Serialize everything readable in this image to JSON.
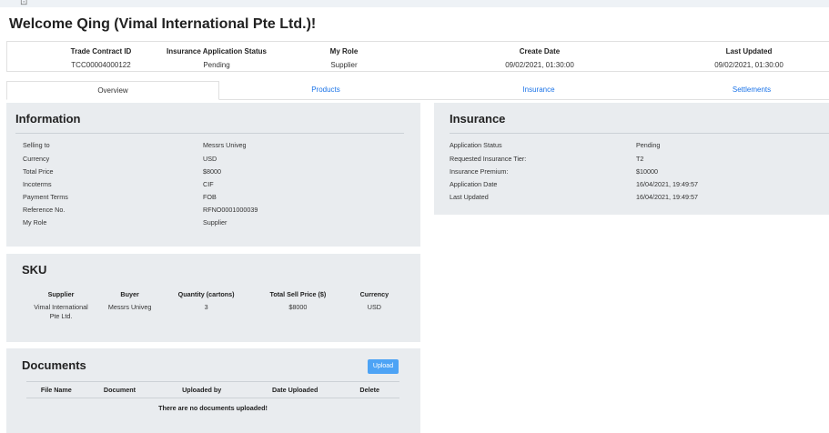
{
  "top_glyph": "⊡",
  "welcome": "Welcome Qing (Vimal International Pte Ltd.)!",
  "summary": {
    "cols": [
      {
        "label": "Trade Contract ID",
        "value": "TCC00004000122"
      },
      {
        "label": "Insurance Application Status",
        "value": "Pending"
      },
      {
        "label": "My Role",
        "value": "Supplier"
      },
      {
        "label": "Create Date",
        "value": "09/02/2021, 01:30:00"
      },
      {
        "label": "Last Updated",
        "value": "09/02/2021, 01:30:00"
      }
    ]
  },
  "tabs": [
    {
      "label": "Overview",
      "active": true
    },
    {
      "label": "Products",
      "active": false
    },
    {
      "label": "Insurance",
      "active": false
    },
    {
      "label": "Settlements",
      "active": false
    }
  ],
  "information": {
    "title": "Information",
    "rows": [
      {
        "key": "Selling to",
        "value": "Messrs Univeg"
      },
      {
        "key": "Currency",
        "value": "USD"
      },
      {
        "key": "Total Price",
        "value": "$8000"
      },
      {
        "key": "Incoterms",
        "value": "CIF"
      },
      {
        "key": "Payment Terms",
        "value": "FOB"
      },
      {
        "key": "Reference No.",
        "value": "RFNO0001000039"
      },
      {
        "key": "My Role",
        "value": "Supplier"
      }
    ]
  },
  "insurance": {
    "title": "Insurance",
    "rows": [
      {
        "key": "Application Status",
        "value": "Pending"
      },
      {
        "key": "Requested Insurance Tier:",
        "value": "T2"
      },
      {
        "key": "Insurance Premium:",
        "value": "$10000"
      },
      {
        "key": "Application Date",
        "value": "16/04/2021, 19:49:57"
      },
      {
        "key": "Last Updated",
        "value": "16/04/2021, 19:49:57"
      }
    ]
  },
  "sku": {
    "title": "SKU",
    "headers": [
      "Supplier",
      "Buyer",
      "Quantity (cartons)",
      "Total Sell Price ($)",
      "Currency"
    ],
    "rows": [
      [
        "Vimal International Pte Ltd.",
        "Messrs Univeg",
        "3",
        "$8000",
        "USD"
      ]
    ]
  },
  "documents": {
    "title": "Documents",
    "upload_label": "Upload",
    "headers": [
      "File Name",
      "Document",
      "Uploaded by",
      "Date Uploaded",
      "Delete"
    ],
    "empty_message": "There are no documents uploaded!"
  },
  "colors": {
    "card_bg": "#e9ecef",
    "link": "#1a73e8",
    "upload_button": "#4da3f5"
  }
}
